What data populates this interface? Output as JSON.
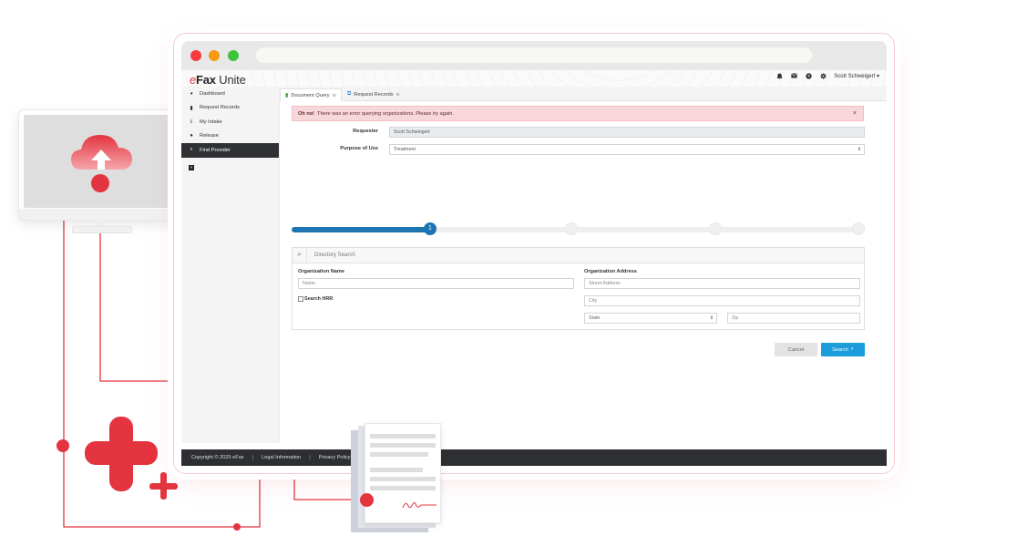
{
  "app": {
    "logo_prefix": "e",
    "logo_brand": "Fax",
    "logo_suffix": " Unite"
  },
  "topbar": {
    "icons": [
      "bell-icon",
      "envelope-icon",
      "help-icon",
      "gear-icon"
    ],
    "user_name": "Scott Schweigert",
    "user_caret": "▾"
  },
  "sidebar": {
    "items": [
      {
        "label": "Dashboard",
        "icon": "dashboard-icon",
        "glyph": "◕",
        "active": false
      },
      {
        "label": "Request Records",
        "icon": "file-icon",
        "glyph": "▮",
        "active": false
      },
      {
        "label": "My Intake",
        "icon": "download-icon",
        "glyph": "⤓",
        "active": false
      },
      {
        "label": "Release",
        "icon": "user-icon",
        "glyph": "●",
        "active": false
      },
      {
        "label": "Find Provider",
        "icon": "search-icon",
        "glyph": "⌕",
        "active": true
      }
    ],
    "collapse_glyph": "«"
  },
  "tabs": [
    {
      "label": "Document Query",
      "icon": "document-icon",
      "active": true
    },
    {
      "label": "Request Records",
      "icon": "external-link-icon",
      "active": false
    }
  ],
  "alert": {
    "strong": "Oh no!",
    "message": "There was an error querying organizations. Please try again.",
    "close": "×"
  },
  "form": {
    "requester_label": "Requester",
    "requester_value": "Scott Schweigert",
    "purpose_label": "Purpose of Use",
    "purpose_value": "Treatment"
  },
  "stepper": {
    "current_step": 1,
    "current_label": "1",
    "total_steps": 4
  },
  "directory": {
    "header": "Directory Search",
    "org_name_label": "Organization Name",
    "name_placeholder": "Name",
    "search_hrr_label": "Search HRR",
    "org_address_label": "Organization Address",
    "street_placeholder": "Street Address",
    "city_placeholder": "City",
    "state_placeholder": "State",
    "zip_placeholder": "Zip"
  },
  "actions": {
    "cancel": "Cancel",
    "search": "Search"
  },
  "footer": {
    "copyright": "Copyright © 2025 eFax",
    "sep": "|",
    "legal": "Legal Information",
    "privacy": "Privacy Policy"
  },
  "colors": {
    "accent_red": "#e4343f",
    "primary_blue": "#1c9ddb",
    "step_blue": "#1d76b2",
    "alert_bg": "#f8d7da",
    "footer_bg": "#2d2f33"
  }
}
